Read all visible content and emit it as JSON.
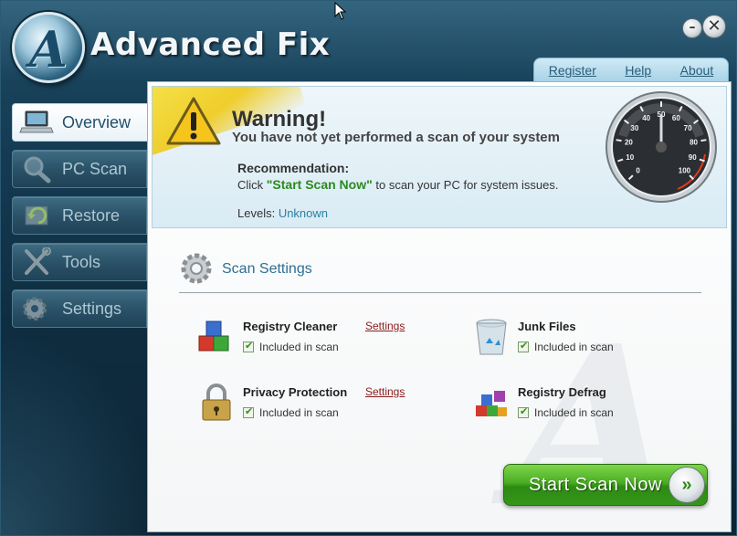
{
  "app": {
    "title": "Advanced Fix",
    "logo_letter": "A"
  },
  "window_controls": {
    "minimize": "–",
    "close": "✕"
  },
  "top_links": [
    "Register",
    "Help",
    "About"
  ],
  "sidebar": {
    "items": [
      {
        "label": "Overview",
        "icon": "laptop-icon",
        "active": true
      },
      {
        "label": "PC Scan",
        "icon": "magnifier-icon",
        "active": false
      },
      {
        "label": "Restore",
        "icon": "restore-arrow-icon",
        "active": false
      },
      {
        "label": "Tools",
        "icon": "tools-icon",
        "active": false
      },
      {
        "label": "Settings",
        "icon": "gear-icon",
        "active": false
      }
    ]
  },
  "warning": {
    "title": "Warning!",
    "subtitle": "You have not yet performed a scan of your system",
    "recommendation_title": "Recommendation:",
    "rec_prefix": "Click ",
    "rec_highlight": "\"Start Scan Now\"",
    "rec_suffix": " to scan your PC for system issues.",
    "levels_label": "Levels: ",
    "levels_value": "Unknown"
  },
  "gauge": {
    "ticks": [
      "0",
      "10",
      "20",
      "30",
      "40",
      "50",
      "60",
      "70",
      "80",
      "90",
      "100"
    ],
    "value": 50
  },
  "scan_settings": {
    "title": "Scan Settings",
    "items": [
      {
        "name": "Registry Cleaner",
        "settings_link": "Settings",
        "status": "Included in scan",
        "icon": "registry-cubes-icon"
      },
      {
        "name": "Junk Files",
        "status": "Included in scan",
        "icon": "recycle-bin-icon"
      },
      {
        "name": "Privacy Protection",
        "settings_link": "Settings",
        "status": "Included in scan",
        "icon": "padlock-icon"
      },
      {
        "name": "Registry Defrag",
        "status": "Included in scan",
        "icon": "defrag-blocks-icon"
      }
    ]
  },
  "start_button": {
    "label": "Start Scan Now",
    "arrow": "»"
  },
  "colors": {
    "accent_green": "#49ad22",
    "link_blue": "#2e6f90",
    "settings_red": "#8b1a1a",
    "frame_dark": "#143a52"
  }
}
